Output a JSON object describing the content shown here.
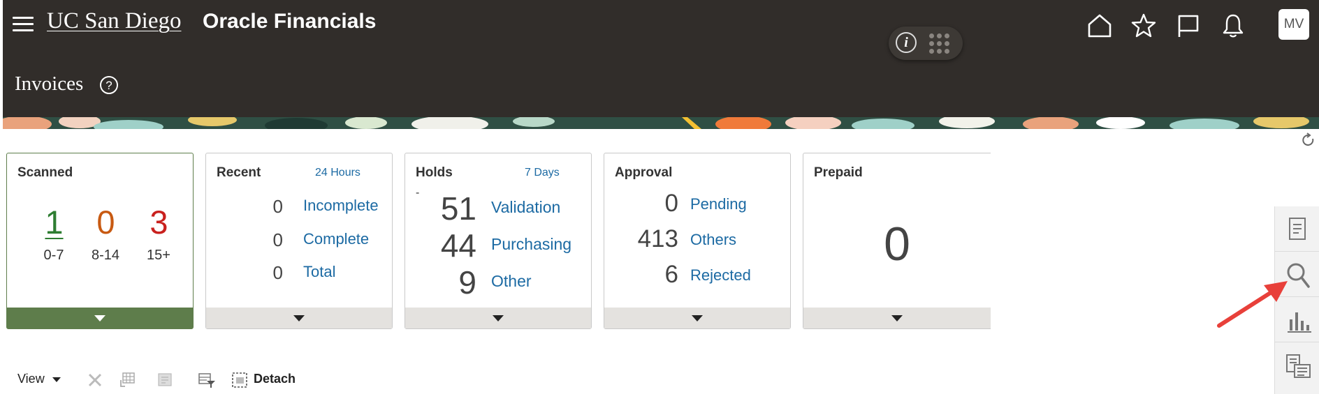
{
  "header": {
    "brand": "UC San Diego",
    "app_name": "Oracle Financials",
    "avatar_initials": "MV",
    "info_glyph": "i"
  },
  "page": {
    "title": "Invoices",
    "help_glyph": "?"
  },
  "tiles": {
    "scanned": {
      "title": "Scanned",
      "buckets": [
        {
          "value": "1",
          "label": "0-7",
          "color": "#2e7d32"
        },
        {
          "value": "0",
          "label": "8-14",
          "color": "#c85a12"
        },
        {
          "value": "3",
          "label": "15+",
          "color": "#c9211e"
        }
      ]
    },
    "recent": {
      "title": "Recent",
      "period": "24 Hours",
      "rows": [
        {
          "count": "0",
          "label": "Incomplete"
        },
        {
          "count": "0",
          "label": "Complete"
        },
        {
          "count": "0",
          "label": "Total"
        }
      ]
    },
    "holds": {
      "title": "Holds",
      "period": "7 Days",
      "dash": "-",
      "rows": [
        {
          "count": "51",
          "label": "Validation"
        },
        {
          "count": "44",
          "label": "Purchasing"
        },
        {
          "count": "9",
          "label": "Other"
        }
      ]
    },
    "approval": {
      "title": "Approval",
      "rows": [
        {
          "count": "0",
          "label": "Pending"
        },
        {
          "count": "413",
          "label": "Others"
        },
        {
          "count": "6",
          "label": "Rejected"
        }
      ]
    },
    "prepaid": {
      "title": "Prepaid",
      "count": "0"
    }
  },
  "toolbar": {
    "view_label": "View",
    "detach_label": "Detach"
  },
  "icons": {
    "menu": "hamburger-icon",
    "home": "home-icon",
    "favorites": "star-icon",
    "watchlist": "flag-icon",
    "notifications": "bell-icon",
    "refresh": "refresh-icon",
    "rail": [
      "document-icon",
      "search-icon",
      "bar-chart-icon",
      "list-icon"
    ]
  },
  "colors": {
    "header_bg": "#312d2a",
    "link": "#1c6aa3",
    "scanned_accent": "#5e7d4b",
    "annotation_arrow": "#e8403a"
  }
}
